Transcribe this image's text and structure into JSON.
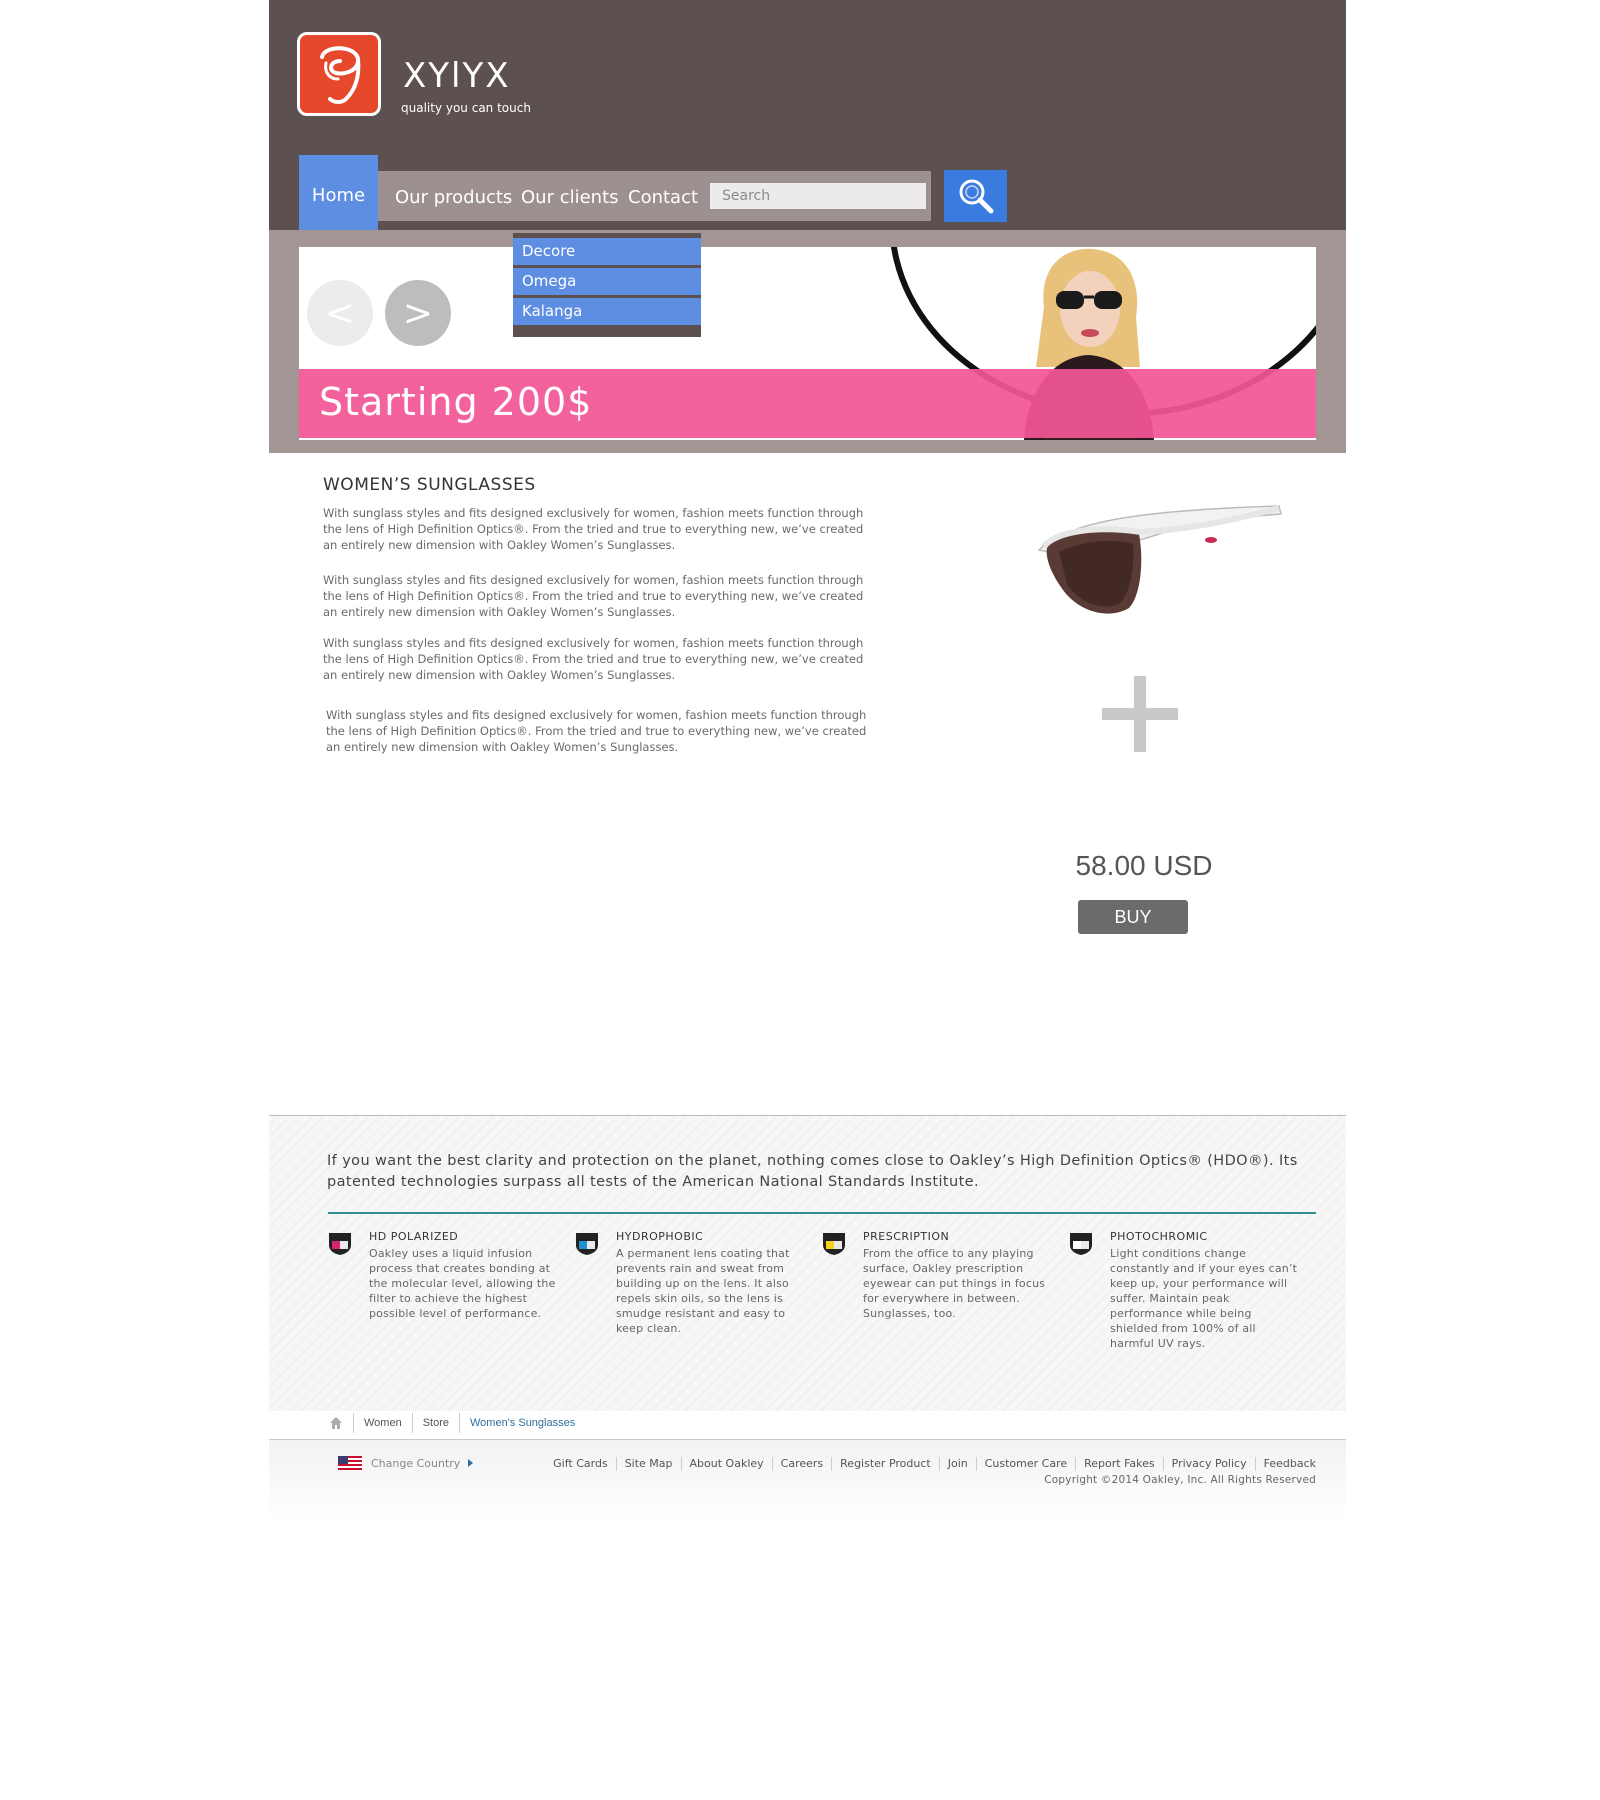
{
  "header": {
    "brand": "XYlYX",
    "tagline": "quality you can touch",
    "nav": {
      "home": "Home",
      "products": "Our products",
      "clients": "Our clients",
      "contact": "Contact"
    },
    "search": {
      "placeholder": "Search"
    },
    "dropdown": [
      "Decore",
      "Omega",
      "Kalanga"
    ]
  },
  "banner": {
    "promo": "Starting 200$",
    "prev": "<",
    "next": ">"
  },
  "main": {
    "title": "WOMEN’S SUNGLASSES",
    "paragraphs": [
      "With sunglass styles and fits designed exclusively for women, fashion meets function through the lens of High Definition Optics®. From the tried and true to everything new, we’ve created an entirely new dimension with Oakley Women’s Sunglasses.",
      "With sunglass styles and fits designed exclusively for women, fashion meets function through the lens of High Definition Optics®. From the tried and true to everything new, we’ve created an entirely new dimension with Oakley Women’s Sunglasses.",
      "With sunglass styles and fits designed exclusively for women, fashion meets function through the lens of High Definition Optics®. From the tried and true to everything new, we’ve created an entirely new dimension with Oakley Women’s Sunglasses.",
      "With sunglass styles and fits designed exclusively for women, fashion meets function through the lens of High Definition Optics®. From the tried and true to everything new, we’ve created an entirely new dimension with Oakley Women’s Sunglasses."
    ],
    "price": "58.00 USD",
    "buy": "BUY"
  },
  "footer": {
    "intro": "If you want the best clarity and protection on the planet, nothing comes close to Oakley’s High Definition Optics® (HDO®). Its patented technologies surpass all tests of the American National Standards Institute.",
    "features": [
      {
        "title": "HD POLARIZED",
        "text": "Oakley uses a liquid infusion process that creates bonding at the molecular level, allowing the filter to achieve the highest possible level of performance.",
        "icon": "hd-polarized-icon",
        "color": "#d6246e"
      },
      {
        "title": "HYDROPHOBIC",
        "text": "A permanent lens coating that prevents rain and sweat from building up on the lens. It also repels skin oils, so the lens is smudge resistant and easy to keep clean.",
        "icon": "hydrophobic-icon",
        "color": "#1f8fd0"
      },
      {
        "title": "PRESCRIPTION",
        "text": "From the office to any playing surface, Oakley prescription eyewear can put things in focus for everywhere in between. Sunglasses, too.",
        "icon": "prescription-icon",
        "color": "#f2d21b"
      },
      {
        "title": "PHOTOCHROMIC",
        "text": "Light conditions change constantly and if your eyes can’t keep up, your performance will suffer. Maintain peak performance while being shielded from 100% of all harmful UV rays.",
        "icon": "photochromic-icon",
        "color": "#ffffff"
      }
    ],
    "breadcrumb": [
      "Women",
      "Store",
      "Women's Sunglasses"
    ],
    "change_country": "Change Country",
    "links": [
      "Gift Cards",
      "Site Map",
      "About Oakley",
      "Careers",
      "Register Product",
      "Join",
      "Customer Care",
      "Report Fakes",
      "Privacy Policy",
      "Feedback"
    ],
    "copyright": "Copyright ©2014 Oakley, Inc. All Rights Reserved"
  },
  "colors": {
    "header_bg": "#5c5150",
    "nav_active": "#5d8ee2",
    "search_button": "#3a7be0",
    "promo_bar": "#f25695",
    "buy_button": "#6b6b6b",
    "logo_red": "#e5482b",
    "teal_rule": "#2f8c8f"
  }
}
